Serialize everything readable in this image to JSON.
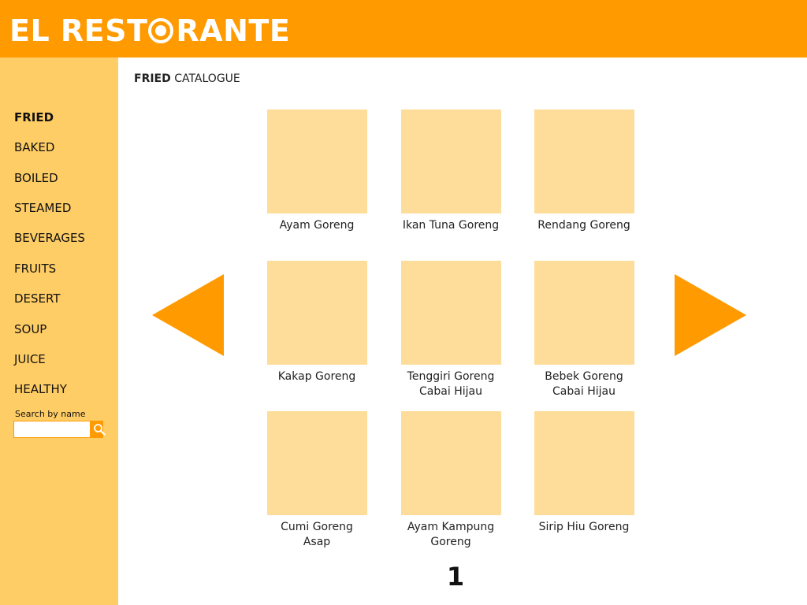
{
  "header": {
    "logo_left": "EL REST",
    "logo_right": "RANTE"
  },
  "sidebar": {
    "items": [
      {
        "label": "FRIED",
        "active": true
      },
      {
        "label": "BAKED"
      },
      {
        "label": "BOILED"
      },
      {
        "label": "STEAMED"
      },
      {
        "label": "BEVERAGES"
      },
      {
        "label": "FRUITS"
      },
      {
        "label": "DESERT"
      },
      {
        "label": "SOUP"
      },
      {
        "label": "JUICE"
      },
      {
        "label": "HEALTHY"
      }
    ],
    "search_label": "Search by name",
    "search_value": "",
    "search_icon": "search-icon"
  },
  "main": {
    "breadcrumb_bold": "FRIED",
    "breadcrumb_rest": "CATALOGUE",
    "items": [
      {
        "name": "Ayam Goreng"
      },
      {
        "name": "Ikan Tuna Goreng"
      },
      {
        "name": "Rendang Goreng"
      },
      {
        "name": "Kakap Goreng"
      },
      {
        "name": "Tenggiri Goreng\nCabai Hijau"
      },
      {
        "name": "Bebek Goreng\nCabai Hijau"
      },
      {
        "name": "Cumi Goreng\nAsap"
      },
      {
        "name": "Ayam Kampung\nGoreng"
      },
      {
        "name": "Sirip Hiu Goreng"
      }
    ],
    "page_number": "1"
  },
  "colors": {
    "brand_orange": "#ff9a00",
    "sidebar_bg": "#ffcd66",
    "thumb_bg": "#fedd9a"
  }
}
